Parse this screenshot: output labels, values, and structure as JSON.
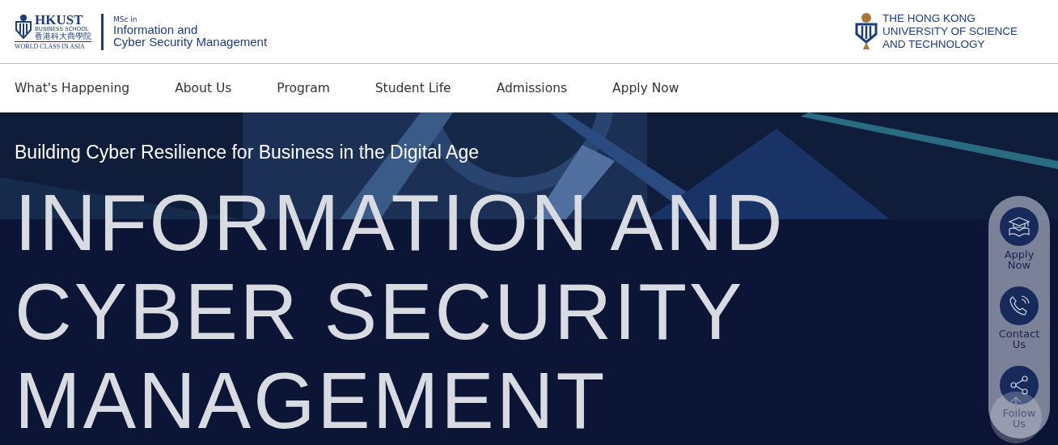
{
  "logo": {
    "name": "HKUST",
    "school": "BUSINESS SCHOOL",
    "chinese": "香港科大商學院",
    "tagline": "WORLD CLASS IN ASIA"
  },
  "program": {
    "prefix": "MSc in",
    "lines": [
      "Information and",
      "Cyber Security Management"
    ]
  },
  "university": {
    "lines": [
      "THE HONG KONG",
      "UNIVERSITY OF SCIENCE",
      "AND TECHNOLOGY"
    ]
  },
  "nav": [
    "What's Happening",
    "About Us",
    "Program",
    "Student Life",
    "Admissions",
    "Apply Now"
  ],
  "hero": {
    "kind": "picture",
    "subtitle": "Building Cyber Resilience for Business in the Digital Age",
    "title_lines": [
      "INFORMATION AND",
      "CYBER SECURITY",
      "MANAGEMENT"
    ]
  },
  "side_actions": [
    {
      "kind": "apply",
      "lines": [
        "Apply",
        "Now"
      ]
    },
    {
      "kind": "contact",
      "lines": [
        "Contact",
        "Us"
      ]
    },
    {
      "kind": "follow",
      "lines": [
        "Follow",
        "Us"
      ]
    }
  ]
}
